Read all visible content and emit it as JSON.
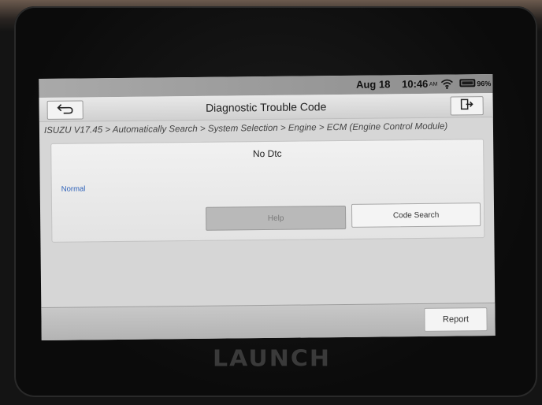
{
  "status_bar": {
    "date": "Aug 18",
    "time": "10:46",
    "ampm": "AM",
    "battery": "96%"
  },
  "header": {
    "title": "Diagnostic Trouble Code",
    "back_icon": "back-arrow-icon",
    "exit_icon": "exit-icon"
  },
  "breadcrumb": "ISUZU V17.45 > Automatically Search > System Selection > Engine > ECM (Engine Control Module)",
  "result": {
    "message": "No Dtc",
    "status": "Normal"
  },
  "buttons": {
    "help": "Help",
    "code_search": "Code Search",
    "report": "Report"
  },
  "device": {
    "brand": "LAUNCH"
  },
  "colors": {
    "status_text": "#2a5fb8",
    "disabled_button": "#b9b9b9"
  }
}
